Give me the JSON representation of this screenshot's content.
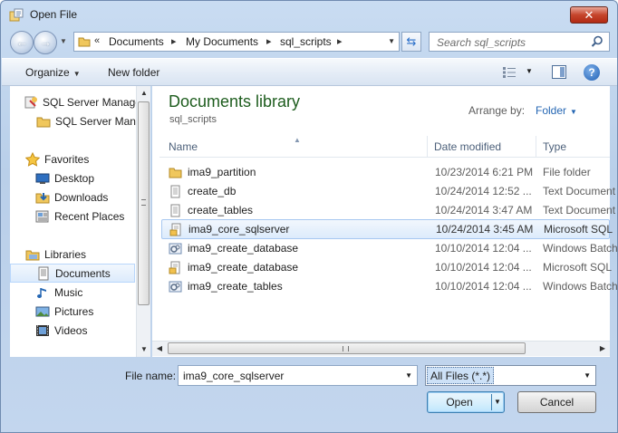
{
  "window": {
    "title": "Open File",
    "close_label": "✕"
  },
  "address": {
    "prefix": "«",
    "parts": [
      "Documents",
      "My Documents",
      "sql_scripts"
    ]
  },
  "search": {
    "placeholder": "Search sql_scripts"
  },
  "toolbar": {
    "organize_label": "Organize",
    "new_folder_label": "New folder",
    "help_label": "?"
  },
  "nav": {
    "items": [
      {
        "label": "SQL Server Management Studio",
        "icon": "sql-server-icon"
      },
      {
        "label": "SQL Server Management Studio",
        "icon": "folder-icon"
      },
      {
        "label": "Favorites",
        "icon": "star-icon"
      },
      {
        "label": "Desktop",
        "icon": "desktop-icon"
      },
      {
        "label": "Downloads",
        "icon": "downloads-icon"
      },
      {
        "label": "Recent Places",
        "icon": "recent-places-icon"
      },
      {
        "label": "Libraries",
        "icon": "libraries-icon"
      },
      {
        "label": "Documents",
        "icon": "documents-icon",
        "selected": true
      },
      {
        "label": "Music",
        "icon": "music-icon"
      },
      {
        "label": "Pictures",
        "icon": "pictures-icon"
      },
      {
        "label": "Videos",
        "icon": "videos-icon"
      }
    ]
  },
  "main": {
    "library_title": "Documents library",
    "library_subtitle": "sql_scripts",
    "arrange_label": "Arrange by:",
    "arrange_value": "Folder",
    "columns": {
      "name": "Name",
      "date": "Date modified",
      "type": "Type"
    },
    "files": [
      {
        "name": "ima9_partition",
        "date": "10/23/2014 6:21 PM",
        "type": "File folder",
        "icon": "folder-icon"
      },
      {
        "name": "create_db",
        "date": "10/24/2014 12:52 ...",
        "type": "Text Document",
        "icon": "text-file-icon"
      },
      {
        "name": "create_tables",
        "date": "10/24/2014 3:47 AM",
        "type": "Text Document",
        "icon": "text-file-icon"
      },
      {
        "name": "ima9_core_sqlserver",
        "date": "10/24/2014 3:45 AM",
        "type": "Microsoft SQL",
        "icon": "sql-file-icon",
        "selected": true
      },
      {
        "name": "ima9_create_database",
        "date": "10/10/2014 12:04 ...",
        "type": "Windows Batch",
        "icon": "batch-file-icon"
      },
      {
        "name": "ima9_create_database",
        "date": "10/10/2014 12:04 ...",
        "type": "Microsoft SQL",
        "icon": "sql-file-icon"
      },
      {
        "name": "ima9_create_tables",
        "date": "10/10/2014 12:04 ...",
        "type": "Windows Batch",
        "icon": "batch-file-icon"
      }
    ]
  },
  "footer": {
    "file_name_label": "File name:",
    "file_name_value": "ima9_core_sqlserver",
    "filter_value": "All Files (*.*)",
    "open_label": "Open",
    "cancel_label": "Cancel"
  },
  "colors": {
    "library_title": "#1e5d1e",
    "link": "#2466b3",
    "selection": "#dcebfc"
  }
}
